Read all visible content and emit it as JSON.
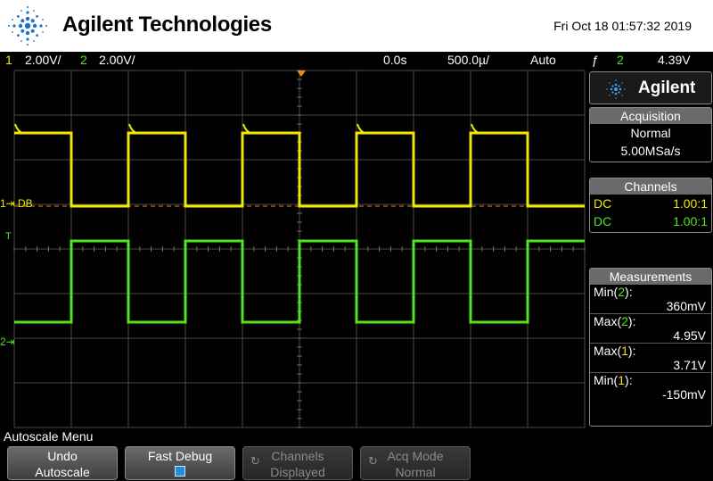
{
  "header": {
    "brand": "Agilent Technologies",
    "datetime": "Fri Oct 18 01:57:32 2019"
  },
  "status_bar": {
    "ch1_num": "1",
    "ch1_scale": "2.00V/",
    "ch2_num": "2",
    "ch2_scale": "2.00V/",
    "time_delay": "0.0s",
    "time_scale": "500.0µ/",
    "trigger_mode": "Auto",
    "trigger_icon": "ƒ",
    "trigger_source": "2",
    "trigger_level": "4.39V"
  },
  "graticule": {
    "ch1_marker": "1⇥",
    "ch2_marker": "2⇥",
    "trig_marker": "T",
    "db_label": "DB"
  },
  "panel": {
    "brand": "Agilent",
    "acquisition": {
      "title": "Acquisition",
      "mode": "Normal",
      "rate": "5.00MSa/s"
    },
    "channels": {
      "title": "Channels",
      "rows": [
        {
          "coupling": "DC",
          "probe": "1.00:1"
        },
        {
          "coupling": "DC",
          "probe": "1.00:1"
        }
      ]
    },
    "measurements": {
      "title": "Measurements",
      "rows": [
        {
          "name": "Min(",
          "ch": "2",
          "close": "):",
          "value": "360mV"
        },
        {
          "name": "Max(",
          "ch": "2",
          "close": "):",
          "value": "4.95V"
        },
        {
          "name": "Max(",
          "ch": "1",
          "close": "):",
          "value": "3.71V"
        },
        {
          "name": "Min(",
          "ch": "1",
          "close": "):",
          "value": "-150mV"
        }
      ]
    }
  },
  "menu": {
    "title": "Autoscale Menu",
    "keys": [
      {
        "line1": "Undo",
        "line2": "Autoscale"
      },
      {
        "line1": "Fast Debug",
        "line2": ""
      },
      {
        "line1": "Channels",
        "line2": "Displayed"
      },
      {
        "line1": "Acq Mode",
        "line2": "Normal"
      }
    ]
  },
  "colors": {
    "ch1": "#f2e900",
    "ch2": "#4ee61e",
    "trigger_marker": "#f08a16",
    "grid": "#4a4a4a"
  }
}
